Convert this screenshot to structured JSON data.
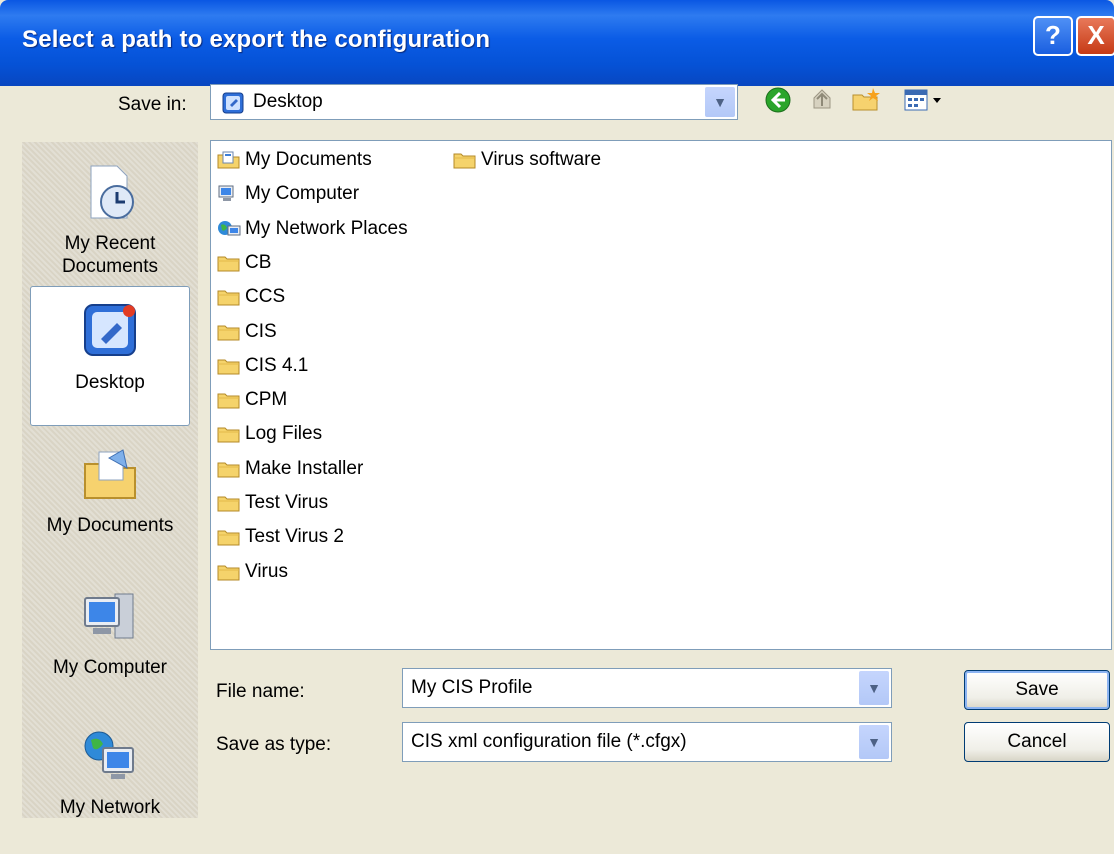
{
  "window": {
    "title": "Select a path to export the configuration",
    "help_label": "?",
    "close_label": "X"
  },
  "save_in": {
    "label": "Save in:",
    "value": "Desktop"
  },
  "toolbar": {
    "icons": [
      "back-icon",
      "up-folder-icon",
      "new-folder-icon",
      "views-menu-icon"
    ]
  },
  "places": [
    {
      "label": "My Recent Documents",
      "icon": "recent-documents-icon"
    },
    {
      "label": "Desktop",
      "icon": "desktop-icon"
    },
    {
      "label": "My Documents",
      "icon": "my-documents-icon"
    },
    {
      "label": "My Computer",
      "icon": "my-computer-icon"
    },
    {
      "label": "My Network",
      "icon": "my-network-icon"
    }
  ],
  "files": {
    "col1": [
      {
        "name": "My Documents",
        "icon": "my-documents-icon"
      },
      {
        "name": "My Computer",
        "icon": "computer-icon"
      },
      {
        "name": "My Network Places",
        "icon": "network-icon"
      },
      {
        "name": "CB",
        "icon": "folder-icon"
      },
      {
        "name": "CCS",
        "icon": "folder-icon"
      },
      {
        "name": "CIS",
        "icon": "folder-icon"
      },
      {
        "name": "CIS 4.1",
        "icon": "folder-icon"
      },
      {
        "name": "CPM",
        "icon": "folder-icon"
      },
      {
        "name": "Log Files",
        "icon": "folder-icon"
      },
      {
        "name": "Make Installer",
        "icon": "folder-icon"
      },
      {
        "name": "Test Virus",
        "icon": "folder-icon"
      },
      {
        "name": "Test Virus 2",
        "icon": "folder-icon"
      },
      {
        "name": "Virus",
        "icon": "folder-icon"
      }
    ],
    "col2": [
      {
        "name": "Virus software",
        "icon": "folder-icon"
      }
    ]
  },
  "file_name": {
    "label": "File name:",
    "value": "My CIS Profile"
  },
  "save_type": {
    "label": "Save as type:",
    "value": "CIS xml configuration file (*.cfgx)"
  },
  "buttons": {
    "save": "Save",
    "cancel": "Cancel"
  }
}
